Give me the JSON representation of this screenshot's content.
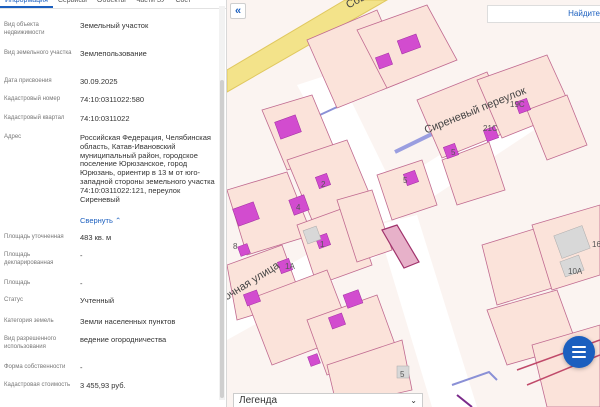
{
  "tabs": [
    {
      "label": "Информация",
      "active": true
    },
    {
      "label": "Сервисы",
      "active": false
    },
    {
      "label": "Объекты",
      "active": false
    },
    {
      "label": "Части ЗУ",
      "active": false
    },
    {
      "label": "Сост",
      "active": false
    }
  ],
  "info": {
    "object_type": {
      "label": "Вид объекта недвижимости",
      "value": "Земельный участок"
    },
    "land_type": {
      "label": "Вид земельного участка",
      "value": "Землепользование"
    },
    "assigned_date": {
      "label": "Дата присвоения",
      "value": "30.09.2025"
    },
    "cadastral_number": {
      "label": "Кадастровый номер",
      "value": "74:10:0311022:580"
    },
    "cadastral_quarter": {
      "label": "Кадастровый квартал",
      "value": "74:10:0311022"
    },
    "address": {
      "label": "Адрес",
      "value": "Российская Федерация, Челябинская область, Катав-Ивановский муниципальный район, городское поселение Юрюзанское, город Юрюзань, ориентир в 13 м от юго-западной стороны земельного участка 74:10:0311022:121, переулок Сиреневый",
      "collapse": "Свернуть ⌃"
    },
    "declared_area": {
      "label": "Площадь уточненная",
      "value": "483 кв. м"
    },
    "declared_area2": {
      "label": "Площадь декларированная",
      "value": "-"
    },
    "area": {
      "label": "Площадь",
      "value": "-"
    },
    "status": {
      "label": "Статус",
      "value": "Учтенный"
    },
    "land_category": {
      "label": "Категория земель",
      "value": "Земли населенных пунктов"
    },
    "permitted_use": {
      "label": "Вид разрешенного использования",
      "value": "ведение огородничества"
    },
    "ownership": {
      "label": "Форма собственности",
      "value": "-"
    },
    "cadastral_value": {
      "label": "Кадастровая стоимость",
      "value": "3 455,93 руб."
    }
  },
  "map": {
    "collapse_icon": "«",
    "search_text": "Найдите",
    "streets": {
      "top": "Сов",
      "lane": "Сиреневый переулок",
      "bottom": "очная улица"
    },
    "plot_numbers": [
      "19С",
      "21С",
      "5",
      "5",
      "2",
      "4",
      "1",
      "1А",
      "8",
      "16",
      "10А",
      "5"
    ],
    "legend_label": "Легенда",
    "legend_chevron": "⌄",
    "colors": {
      "parcel_border": "#c06a90",
      "building": "#d24ccf",
      "road": "#f3e38a",
      "highlight": "#9a9ee0"
    }
  }
}
